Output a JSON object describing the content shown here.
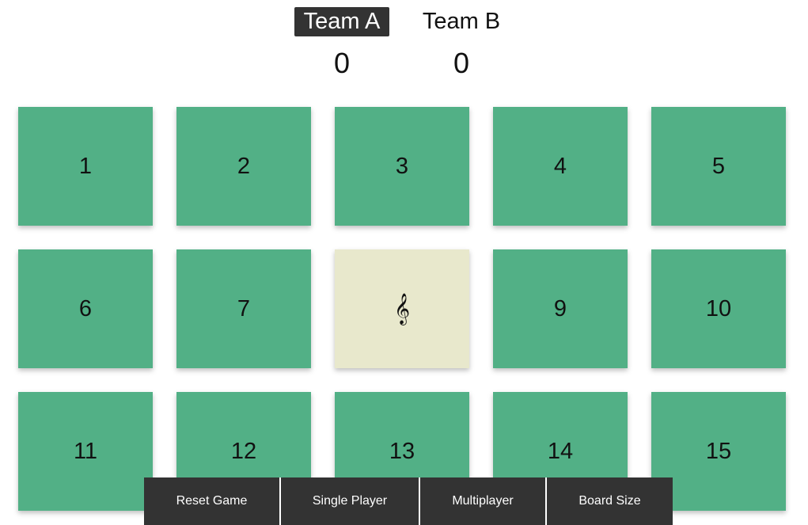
{
  "teams": {
    "a": {
      "name": "Team A",
      "score": "0",
      "active": true
    },
    "b": {
      "name": "Team B",
      "score": "0",
      "active": false
    }
  },
  "board": {
    "tiles": [
      {
        "label": "1"
      },
      {
        "label": "2"
      },
      {
        "label": "3"
      },
      {
        "label": "4"
      },
      {
        "label": "5"
      },
      {
        "label": "6"
      },
      {
        "label": "7"
      },
      {
        "label": "𝄞",
        "revealed": true,
        "icon": "treble-clef-icon"
      },
      {
        "label": "9"
      },
      {
        "label": "10"
      },
      {
        "label": "11"
      },
      {
        "label": "12"
      },
      {
        "label": "13"
      },
      {
        "label": "14"
      },
      {
        "label": "15"
      }
    ],
    "tile_color": "#52b086",
    "revealed_color": "#e8e8cc"
  },
  "controls": {
    "reset": "Reset Game",
    "single": "Single Player",
    "multi": "Multiplayer",
    "size": "Board Size"
  },
  "colors": {
    "bar": "#333333",
    "active_team_bg": "#333333"
  }
}
